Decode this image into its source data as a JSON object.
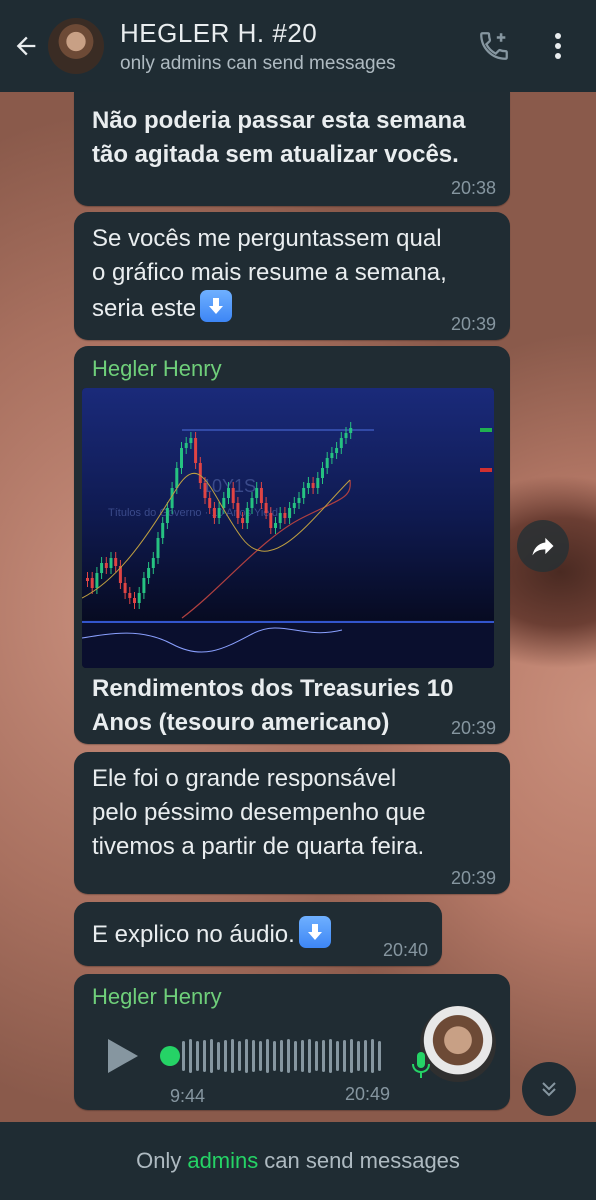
{
  "header": {
    "title": "HEGLER H. #20",
    "subtitle": "only admins can send messages"
  },
  "messages": [
    {
      "text_line1": "Não poderia passar esta semana",
      "text_line2": "tão agitada sem atualizar vocês.",
      "time": "20:38"
    },
    {
      "text_line1": "Se vocês me perguntassem qual",
      "text_line2": "o gráfico mais resume a semana,",
      "text_line3": "seria este",
      "time": "20:39"
    },
    {
      "sender": "Hegler Henry",
      "caption_line1": "Rendimentos dos Treasuries 10",
      "caption_line2": "Anos (tesouro americano)",
      "time": "20:39",
      "chart_watermark_line1": "10Y1S",
      "chart_watermark_line2": "Títulos do Governo · 10 Anos Yield"
    },
    {
      "text_line1": "Ele foi o grande responsável",
      "text_line2": "pelo péssimo desempenho que",
      "text_line3": "tivemos a partir de quarta feira.",
      "time": "20:39"
    },
    {
      "text_line1": "E explico no áudio.",
      "time": "20:40"
    },
    {
      "sender": "Hegler Henry",
      "duration": "9:44",
      "time": "20:49"
    }
  ],
  "footer": {
    "prefix": "Only",
    "highlight": "admins",
    "suffix": "can send messages"
  },
  "colors": {
    "header_bg": "#1f2c33",
    "bubble_bg": "#202c33",
    "sender": "#6fcf7a",
    "accent": "#25d366"
  },
  "icons": [
    "back-arrow-icon",
    "add-call-icon",
    "more-vert-icon",
    "down-arrow-emoji-icon",
    "forward-icon",
    "play-icon",
    "mic-icon",
    "scroll-down-icon"
  ]
}
